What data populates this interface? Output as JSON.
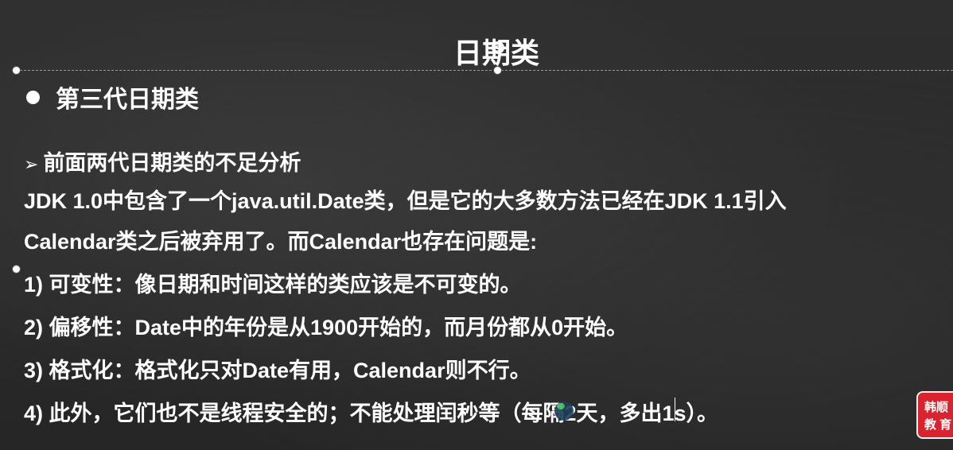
{
  "slide": {
    "title": "日期类",
    "subtitle": "第三代日期类",
    "section_heading": "前面两代日期类的不足分析",
    "intro_line1": "JDK 1.0中包含了一个java.util.Date类，但是它的大多数方法已经在JDK 1.1引入",
    "intro_line2": "Calendar类之后被弃用了。而Calendar也存在问题是:",
    "points": [
      "1) 可变性：像日期和时间这样的类应该是不可变的。",
      "2) 偏移性：Date中的年份是从1900开始的，而月份都从0开始。",
      "3) 格式化：格式化只对Date有用，Calendar则不行。",
      "4) 此外，它们也不是线程安全的；不能处理闰秒等（每隔2天，多出1s）。"
    ]
  },
  "logo": {
    "line1": "韩顺",
    "line2": "教 育"
  },
  "icons": {
    "rotate": "rotate-handle-icon",
    "bullet": "bullet-dot-icon",
    "arrow": "arrow-right-icon"
  }
}
